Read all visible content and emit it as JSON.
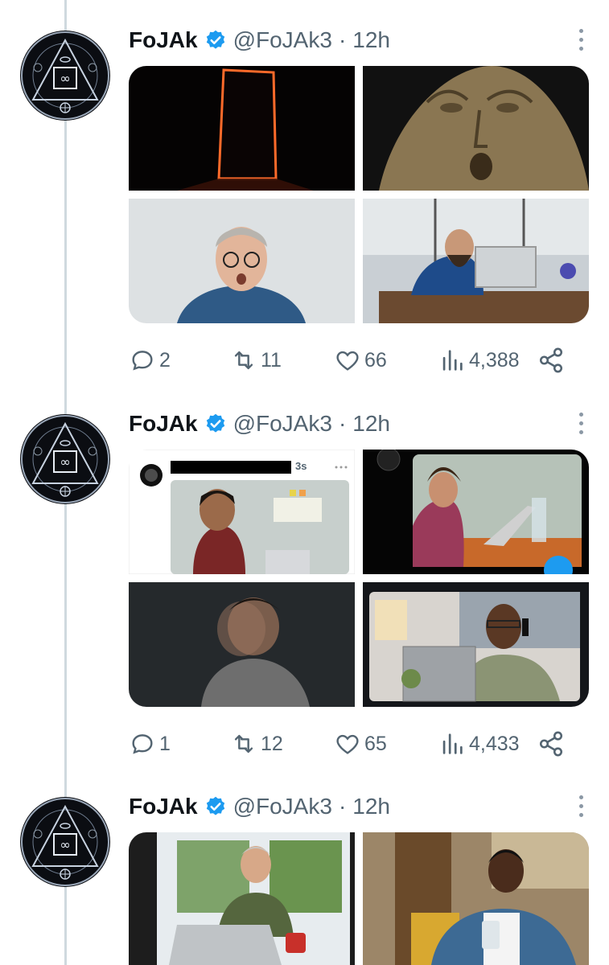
{
  "colors": {
    "verified": "#1d9bf0",
    "secondary_text": "#536471",
    "thread_line": "#cfd9de"
  },
  "tweets": [
    {
      "name": "FoJAk",
      "handle": "@FoJAk3",
      "separator": "·",
      "time": "12h",
      "images": [
        "glowing-door-in-dark-photo",
        "surprised-stone-face-statue-photo",
        "shocked-man-glasses-photo",
        "stressed-man-at-laptop-photo"
      ],
      "stats": {
        "replies": "2",
        "retweets": "11",
        "likes": "66",
        "views": "4,388"
      }
    },
    {
      "name": "FoJAk",
      "handle": "@FoJAk3",
      "separator": "·",
      "time": "12h",
      "images": [
        "screenshot-shocked-man-trading-chart",
        "screenshot-shocked-woman-laptop",
        "blurred-man-shaking-head-photo",
        "screenshot-worried-man-on-phone-laptop"
      ],
      "embedded_time": "3s",
      "stats": {
        "replies": "1",
        "retweets": "12",
        "likes": "65",
        "views": "4,433"
      }
    },
    {
      "name": "FoJAk",
      "handle": "@FoJAk3",
      "separator": "·",
      "time": "12h",
      "images": [
        "worried-older-man-at-laptop-photo",
        "stressed-man-looking-at-phone-photo"
      ]
    }
  ]
}
